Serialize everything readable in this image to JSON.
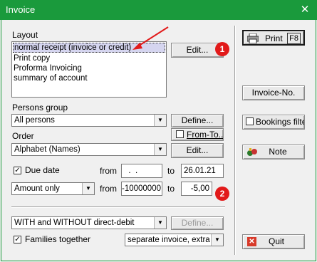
{
  "window": {
    "title": "Invoice",
    "close_glyph": "✕"
  },
  "layout_section": {
    "label": "Layout",
    "items": [
      "normal receipt (invoice or credit)",
      "Print copy",
      "Proforma Invoicing",
      "summary of account"
    ],
    "edit_button": "Edit...",
    "badge": "1"
  },
  "persons_group": {
    "label": "Persons group",
    "value": "All persons",
    "define_button": "Define..."
  },
  "from_to": {
    "label": "From-To..."
  },
  "order": {
    "label": "Order",
    "value": "Alphabet (Names)",
    "edit_button": "Edit..."
  },
  "due_date": {
    "label": "Due date",
    "from_label": "from",
    "from_value": "  .  .",
    "to_label": "to",
    "to_value": "26.01.21"
  },
  "amount": {
    "mode": "Amount only",
    "from_label": "from",
    "from_value": "-10000000",
    "to_label": "to",
    "to_value": "-5,00",
    "badge": "2"
  },
  "direct_debit": {
    "value": "WITH and WITHOUT direct-debit",
    "define_button": "Define..."
  },
  "families": {
    "label": "Families together",
    "value": "separate invoice, extra"
  },
  "right_panel": {
    "print_button": "Print",
    "print_key": "F8",
    "invoice_no_button": "Invoice-No.",
    "bookings_filter_button": "Bookings filter",
    "note_button": "Note",
    "quit_button": "Quit"
  },
  "colors": {
    "title_bar": "#1a9a3c",
    "badge": "#e21a1a",
    "arrow": "#e21a1a",
    "selection": "#d5d5ef"
  }
}
